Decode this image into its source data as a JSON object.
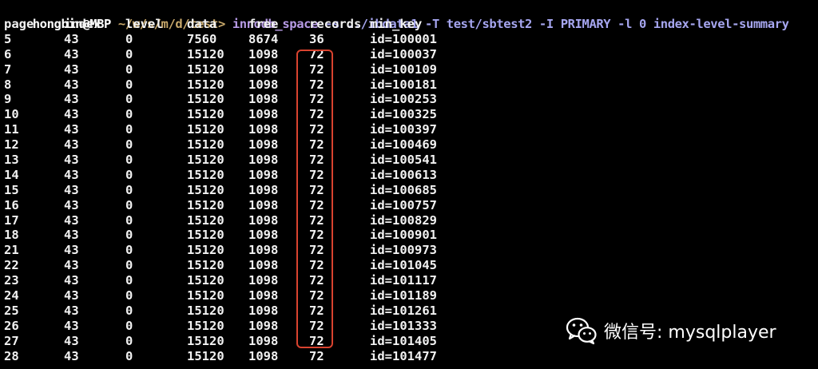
{
  "prompt": {
    "user_host": "hongbin@MBP",
    "path": " ~/w/s/m/d/test>",
    "command": " innodb_space",
    "args": " -s ../ibdata1 -T test/sbtest2 -I PRIMARY -l 0 index-level-summary"
  },
  "table": {
    "headers": [
      "page",
      "index",
      "level",
      "data",
      "free",
      "records",
      "min_key"
    ],
    "rows": [
      [
        "5",
        "43",
        "0",
        "7560",
        "8674",
        "36",
        "id=100001"
      ],
      [
        "6",
        "43",
        "0",
        "15120",
        "1098",
        "72",
        "id=100037"
      ],
      [
        "7",
        "43",
        "0",
        "15120",
        "1098",
        "72",
        "id=100109"
      ],
      [
        "8",
        "43",
        "0",
        "15120",
        "1098",
        "72",
        "id=100181"
      ],
      [
        "9",
        "43",
        "0",
        "15120",
        "1098",
        "72",
        "id=100253"
      ],
      [
        "10",
        "43",
        "0",
        "15120",
        "1098",
        "72",
        "id=100325"
      ],
      [
        "11",
        "43",
        "0",
        "15120",
        "1098",
        "72",
        "id=100397"
      ],
      [
        "12",
        "43",
        "0",
        "15120",
        "1098",
        "72",
        "id=100469"
      ],
      [
        "13",
        "43",
        "0",
        "15120",
        "1098",
        "72",
        "id=100541"
      ],
      [
        "14",
        "43",
        "0",
        "15120",
        "1098",
        "72",
        "id=100613"
      ],
      [
        "15",
        "43",
        "0",
        "15120",
        "1098",
        "72",
        "id=100685"
      ],
      [
        "16",
        "43",
        "0",
        "15120",
        "1098",
        "72",
        "id=100757"
      ],
      [
        "17",
        "43",
        "0",
        "15120",
        "1098",
        "72",
        "id=100829"
      ],
      [
        "18",
        "43",
        "0",
        "15120",
        "1098",
        "72",
        "id=100901"
      ],
      [
        "21",
        "43",
        "0",
        "15120",
        "1098",
        "72",
        "id=100973"
      ],
      [
        "22",
        "43",
        "0",
        "15120",
        "1098",
        "72",
        "id=101045"
      ],
      [
        "23",
        "43",
        "0",
        "15120",
        "1098",
        "72",
        "id=101117"
      ],
      [
        "24",
        "43",
        "0",
        "15120",
        "1098",
        "72",
        "id=101189"
      ],
      [
        "25",
        "43",
        "0",
        "15120",
        "1098",
        "72",
        "id=101261"
      ],
      [
        "26",
        "43",
        "0",
        "15120",
        "1098",
        "72",
        "id=101333"
      ],
      [
        "27",
        "43",
        "0",
        "15120",
        "1098",
        "72",
        "id=101405"
      ],
      [
        "28",
        "43",
        "0",
        "15120",
        "1098",
        "72",
        "id=101477"
      ]
    ]
  },
  "watermark": {
    "icon": "wechat-icon",
    "text": "微信号: mysqlplayer"
  },
  "colors": {
    "background": "#000000",
    "text": "#f2f2f2",
    "highlight_border": "#d9432f",
    "prompt_path": "#c8a86a",
    "prompt_command": "#b79be6"
  }
}
